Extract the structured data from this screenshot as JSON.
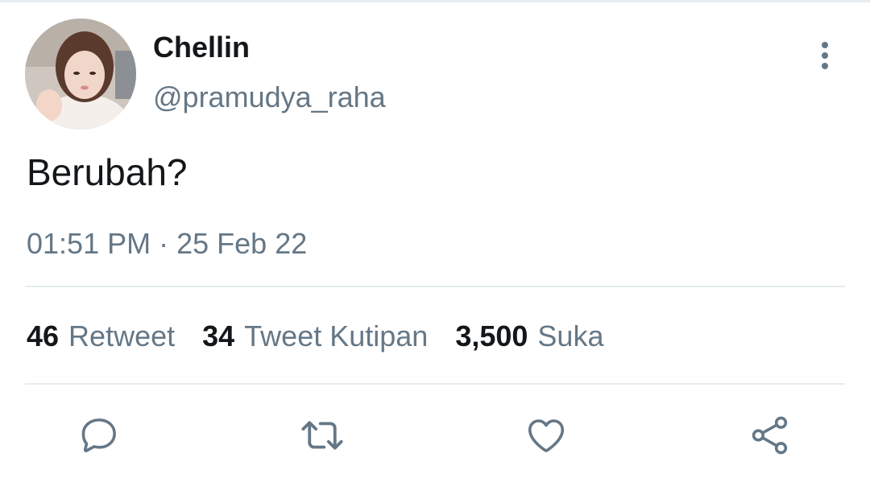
{
  "tweet": {
    "author": {
      "display_name": "Chellin",
      "handle": "@pramudya_raha"
    },
    "text": "Berubah?",
    "time": "01:51 PM",
    "separator": "·",
    "date": "25 Feb 22",
    "stats": [
      {
        "count": "46",
        "label": "Retweet"
      },
      {
        "count": "34",
        "label": "Tweet Kutipan"
      },
      {
        "count": "3,500",
        "label": "Suka"
      }
    ]
  },
  "icons": {
    "more": "more-vertical-icon",
    "reply": "reply-icon",
    "retweet": "retweet-icon",
    "like": "heart-icon",
    "share": "share-icon"
  },
  "colors": {
    "text_primary": "#14171a",
    "text_secondary": "#657786",
    "divider": "#e6ecf0",
    "icon": "#657786"
  }
}
